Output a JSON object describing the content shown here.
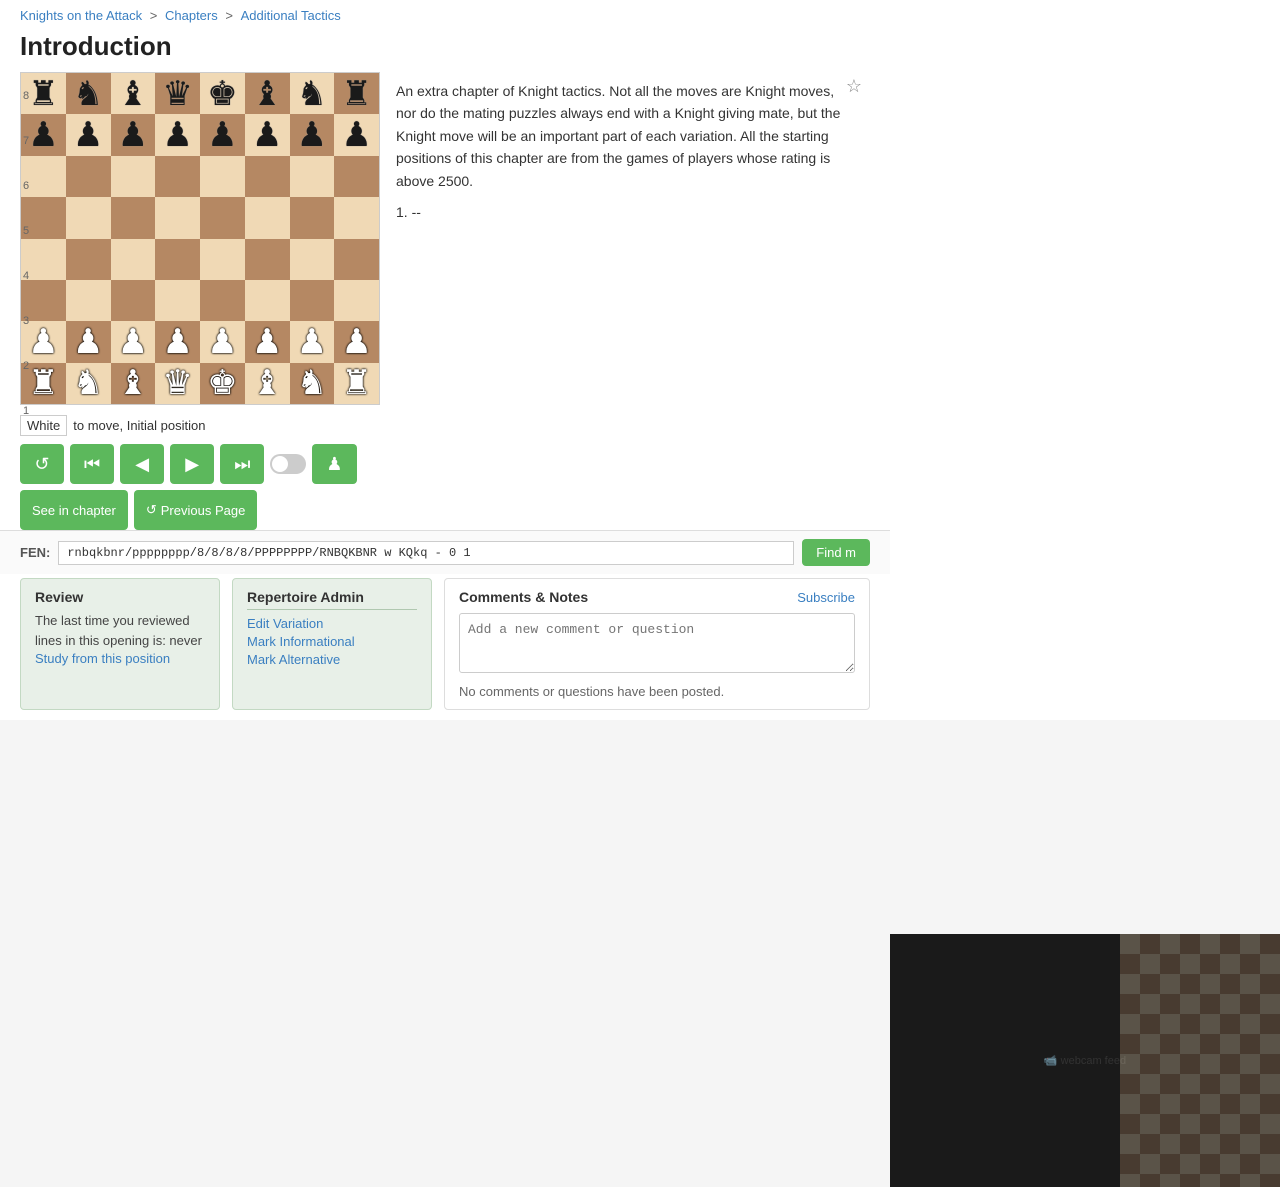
{
  "breadcrumb": {
    "items": [
      {
        "label": "Knights on the Attack",
        "href": "#"
      },
      {
        "label": "Chapters",
        "href": "#"
      },
      {
        "label": "Additional Tactics",
        "href": "#"
      }
    ],
    "separators": [
      ">",
      ">"
    ]
  },
  "page": {
    "title": "Introduction"
  },
  "board": {
    "position_label": "White",
    "position_text": "to move, Initial position",
    "fen": "rnbqkbnr/pppppppp/8/8/8/8/PPPPPPPP/RNBQKBNR w KQkq - 0 1"
  },
  "controls": {
    "reset_label": "↺",
    "first_label": "⏮",
    "prev_label": "◀",
    "next_label": "▶",
    "last_label": "⏭",
    "see_in_chapter_label": "See in chapter",
    "previous_page_label": "Previous Page"
  },
  "intro": {
    "text": "An extra chapter of Knight tactics. Not all the moves are Knight moves, nor do the mating puzzles always end with a Knight giving mate, but the Knight move will be an important part of each variation. All the starting positions of this chapter are from the games of players whose rating is above 2500.",
    "move": "1. --"
  },
  "fen_bar": {
    "label": "FEN:",
    "value": "rnbqkbnr/pppppppp/8/8/8/8/PPPPPPPP/RNBQKBNR w KQkq - 0 1",
    "find_btn_label": "Find m"
  },
  "review": {
    "title": "Review",
    "text": "The last time you reviewed lines in this opening is: never",
    "link_label": "Study from this position"
  },
  "admin": {
    "title": "Repertoire Admin",
    "links": [
      "Edit Variation",
      "Mark Informational",
      "Mark Alternative"
    ]
  },
  "comments": {
    "title": "Comments & Notes",
    "subscribe_label": "Subscribe",
    "placeholder": "Add a new comment or question",
    "no_comments_text": "No comments or questions have been posted."
  },
  "colors": {
    "green": "#5cb85c",
    "light_square": "#f0d9b5",
    "dark_square": "#b58863"
  }
}
